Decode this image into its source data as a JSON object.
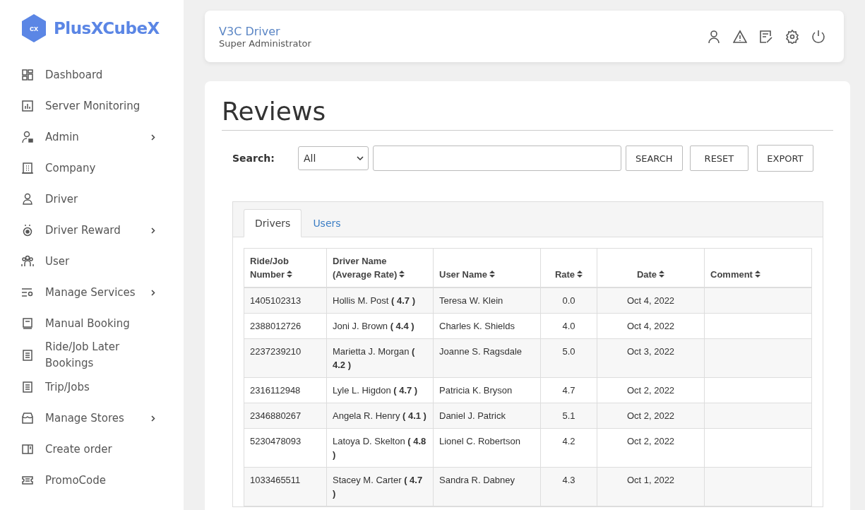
{
  "brand": {
    "logo": "cx",
    "name": "PlusXCubeX"
  },
  "sidebar": {
    "items": [
      {
        "label": "Dashboard",
        "expandable": false
      },
      {
        "label": "Server Monitoring",
        "expandable": false
      },
      {
        "label": "Admin",
        "expandable": true
      },
      {
        "label": "Company",
        "expandable": false
      },
      {
        "label": "Driver",
        "expandable": false
      },
      {
        "label": "Driver Reward",
        "expandable": true
      },
      {
        "label": "User",
        "expandable": false
      },
      {
        "label": "Manage Services",
        "expandable": true
      },
      {
        "label": "Manual Booking",
        "expandable": false
      },
      {
        "label": "Ride/Job Later Bookings",
        "expandable": false
      },
      {
        "label": "Trip/Jobs",
        "expandable": false
      },
      {
        "label": "Manage Stores",
        "expandable": true
      },
      {
        "label": "Create order",
        "expandable": false
      },
      {
        "label": "PromoCode",
        "expandable": false
      }
    ]
  },
  "header": {
    "user_name": "V3C Driver",
    "role": "Super Administrator"
  },
  "page_title": "Reviews",
  "search": {
    "label": "Search:",
    "filter_value": "All",
    "buttons": [
      "SEARCH",
      "RESET",
      "EXPORT"
    ]
  },
  "tabs": [
    {
      "label": "Drivers",
      "selected": true
    },
    {
      "label": "Users",
      "selected": false
    }
  ],
  "table": {
    "columns": [
      {
        "label": "Ride/Job Number"
      },
      {
        "label": "Driver Name (Average Rate)"
      },
      {
        "label": "User Name"
      },
      {
        "label": "Rate"
      },
      {
        "label": "Date"
      },
      {
        "label": "Comment"
      }
    ],
    "rows": [
      [
        "1405102313",
        "Hollis M. Post **( 4.7 )**",
        "Teresa W. Klein",
        "0.0",
        "Oct 4, 2022",
        ""
      ],
      [
        "2388012726",
        "Joni J. Brown **( 4.4 )**",
        "Charles K. Shields",
        "4.0",
        "Oct 4, 2022",
        ""
      ],
      [
        "2237239210",
        "Marietta J. Morgan **( 4.2 )**",
        "Joanne S. Ragsdale",
        "5.0",
        "Oct 3, 2022",
        ""
      ],
      [
        "2316112948",
        "Lyle L. Higdon **( 4.7 )**",
        "Patricia K. Bryson",
        "4.7",
        "Oct 2, 2022",
        ""
      ],
      [
        "2346880267",
        "Angela R. Henry **( 4.1 )**",
        "Daniel J. Patrick",
        "5.1",
        "Oct 2, 2022",
        ""
      ],
      [
        "5230478093",
        "Latoya D. Skelton **( 4.8 )**",
        "Lionel C. Robertson",
        "4.2",
        "Oct 2, 2022",
        ""
      ],
      [
        "1033465511",
        "Stacey M. Carter **( 4.7 )**",
        "Sandra R. Dabney",
        "4.3",
        "Oct 1, 2022",
        ""
      ]
    ]
  }
}
